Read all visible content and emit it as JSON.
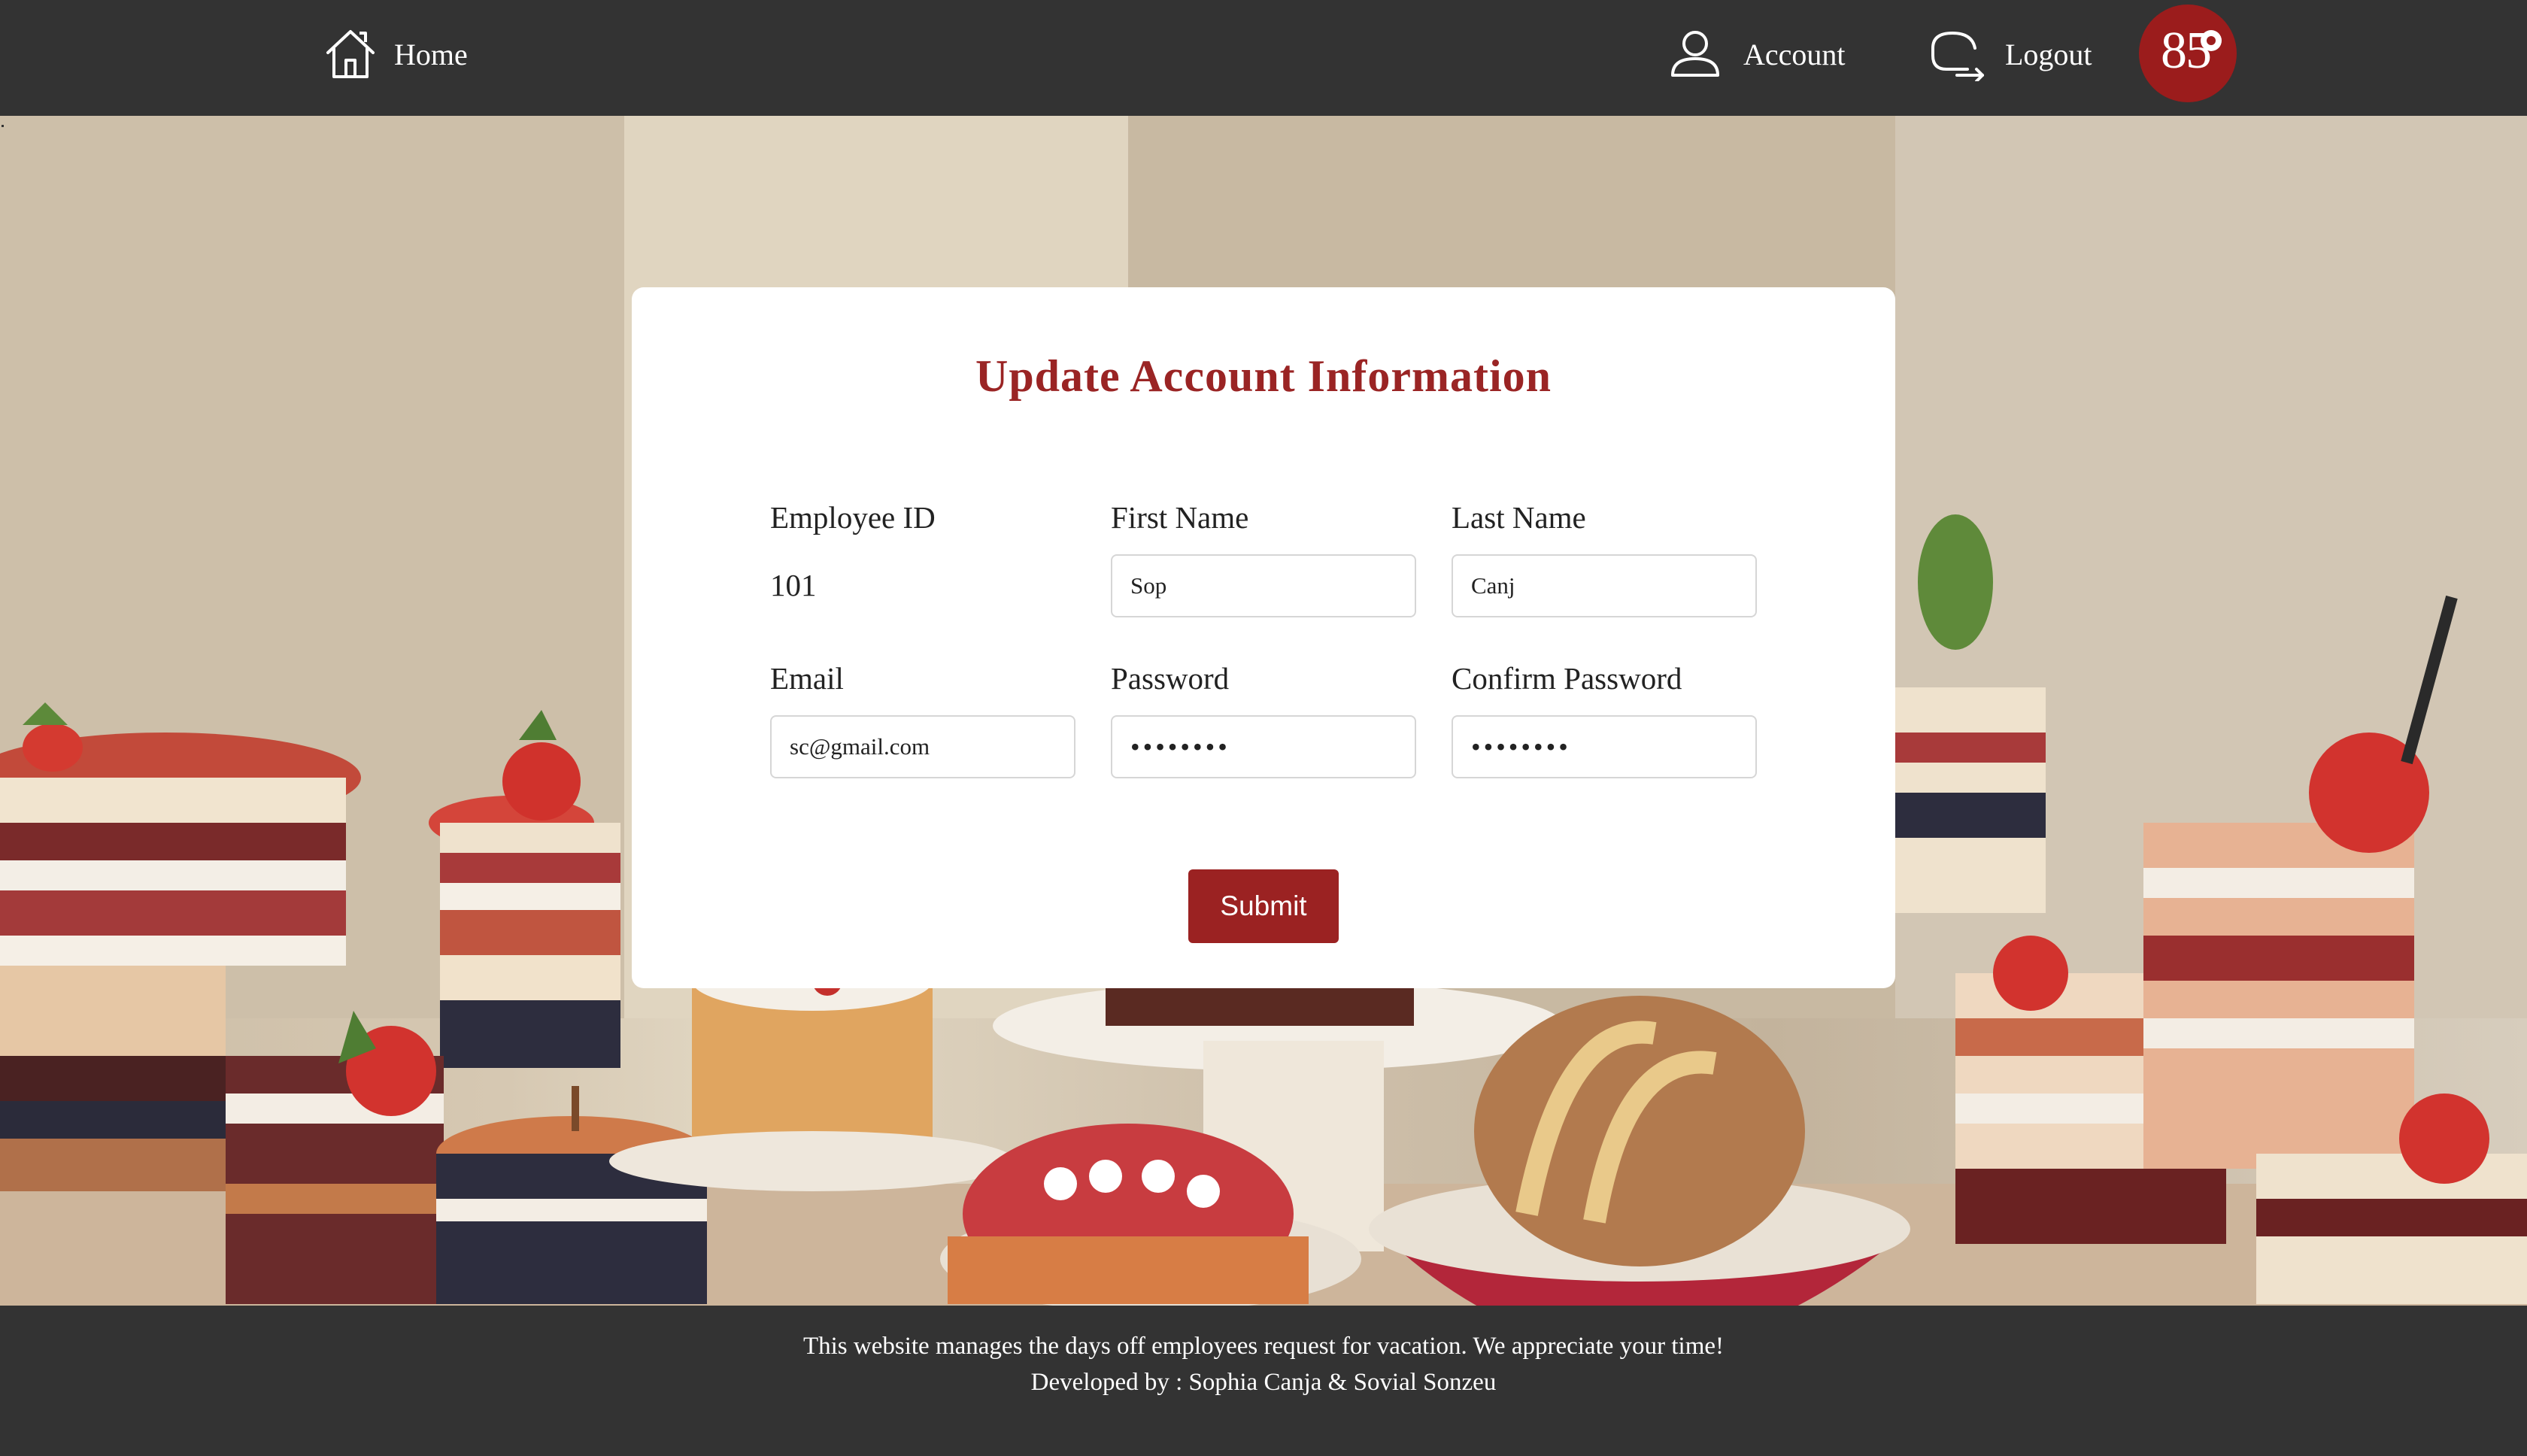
{
  "nav": {
    "home_label": "Home",
    "account_label": "Account",
    "logout_label": "Logout",
    "logo_text": "85"
  },
  "form": {
    "title": "Update Account Information",
    "employee_id_label": "Employee ID",
    "employee_id_value": "101",
    "first_name_label": "First Name",
    "first_name_value": "Sop",
    "last_name_label": "Last Name",
    "last_name_value": "Canj",
    "email_label": "Email",
    "email_value": "sc@gmail.com",
    "password_label": "Password",
    "password_value": "••••••••",
    "confirm_password_label": "Confirm Password",
    "confirm_password_value": "••••••••",
    "submit_label": "Submit"
  },
  "footer": {
    "line1": "This website manages the days off employees request for vacation. We appreciate your time!",
    "line2": "Developed by : Sophia Canja & Sovial Sonzeu"
  },
  "colors": {
    "nav_bg": "#333333",
    "accent": "#9b2222",
    "card_bg": "#ffffff"
  }
}
